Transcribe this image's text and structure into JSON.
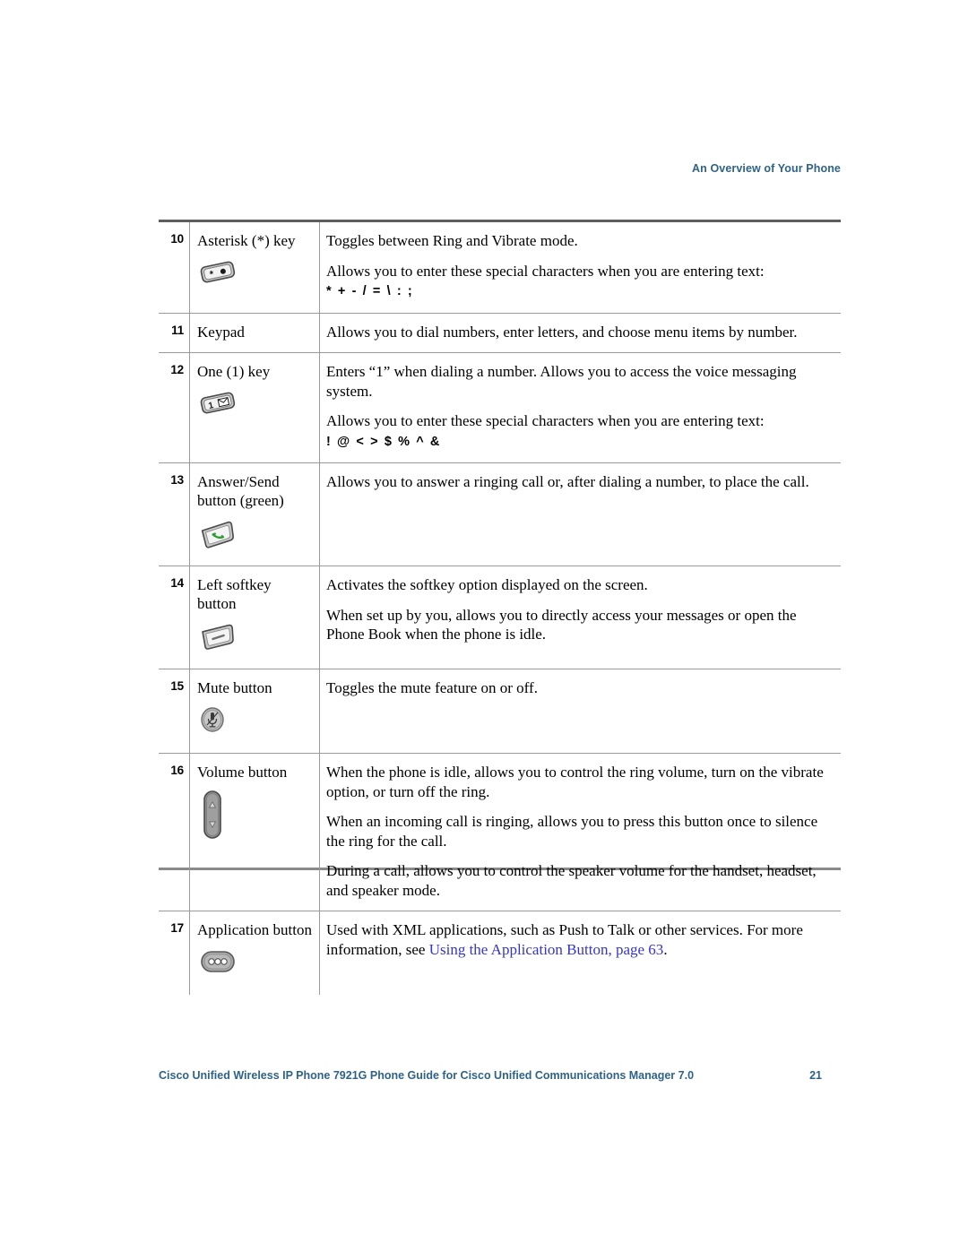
{
  "header": {
    "running_head": "An Overview of Your Phone"
  },
  "table": {
    "rows": [
      {
        "num": "10",
        "name": "Asterisk (*) key",
        "icon": "asterisk-key-icon",
        "paragraphs": [
          {
            "text": "Toggles between Ring and Vibrate mode."
          },
          {
            "text": "Allows you to enter these special characters when you are entering text:"
          }
        ],
        "special_chars": "* + - / = \\ : ;"
      },
      {
        "num": "11",
        "name": "Keypad",
        "icon": null,
        "paragraphs": [
          {
            "text": "Allows you to dial numbers, enter letters, and choose menu items by number."
          }
        ],
        "special_chars": null
      },
      {
        "num": "12",
        "name": "One (1) key",
        "icon": "one-key-icon",
        "paragraphs": [
          {
            "text": "Enters “1” when dialing a number. Allows you to access the voice messaging system."
          },
          {
            "text": "Allows you to enter these special characters when you are entering text:"
          }
        ],
        "special_chars": "! @ < > $ % ^ &"
      },
      {
        "num": "13",
        "name": "Answer/Send button (green)",
        "icon": "answer-send-key-icon",
        "paragraphs": [
          {
            "text": "Allows you to answer a ringing call or, after dialing a number, to place the call."
          }
        ],
        "special_chars": null
      },
      {
        "num": "14",
        "name": "Left softkey button",
        "icon": "left-softkey-icon",
        "paragraphs": [
          {
            "text": "Activates the softkey option displayed on the screen."
          },
          {
            "text": "When set up by you, allows you to directly access your messages or open the Phone Book when the phone is idle."
          }
        ],
        "special_chars": null
      },
      {
        "num": "15",
        "name": "Mute button",
        "icon": "mute-button-icon",
        "paragraphs": [
          {
            "text": "Toggles the mute feature on or off."
          }
        ],
        "special_chars": null
      },
      {
        "num": "16",
        "name": "Volume button",
        "icon": "volume-rocker-icon",
        "paragraphs": [
          {
            "text": "When the phone is idle, allows you to control the ring volume, turn on the vibrate option, or turn off the ring."
          },
          {
            "text": "When an incoming call is ringing, allows you to press this button once to silence the ring for the call."
          },
          {
            "text": "During a call, allows you to control the speaker volume for the handset, headset, and speaker mode."
          }
        ],
        "special_chars": null
      },
      {
        "num": "17",
        "name": "Application button",
        "icon": "application-button-icon",
        "paragraphs": [
          {
            "text": "Used with XML applications, such as Push to Talk or other services. For more information, see ",
            "link": "Using the Application Button, page 63",
            "after": "."
          }
        ],
        "special_chars": null
      }
    ]
  },
  "footer": {
    "title": "Cisco Unified Wireless IP Phone 7921G Phone Guide for Cisco Unified Communications Manager 7.0",
    "page_number": "21"
  },
  "colors": {
    "accent_blue": "#2e6389",
    "xref_blue": "#3435cc",
    "rule_dark": "#5e5e5e",
    "rule_light": "#9a9a9a"
  }
}
